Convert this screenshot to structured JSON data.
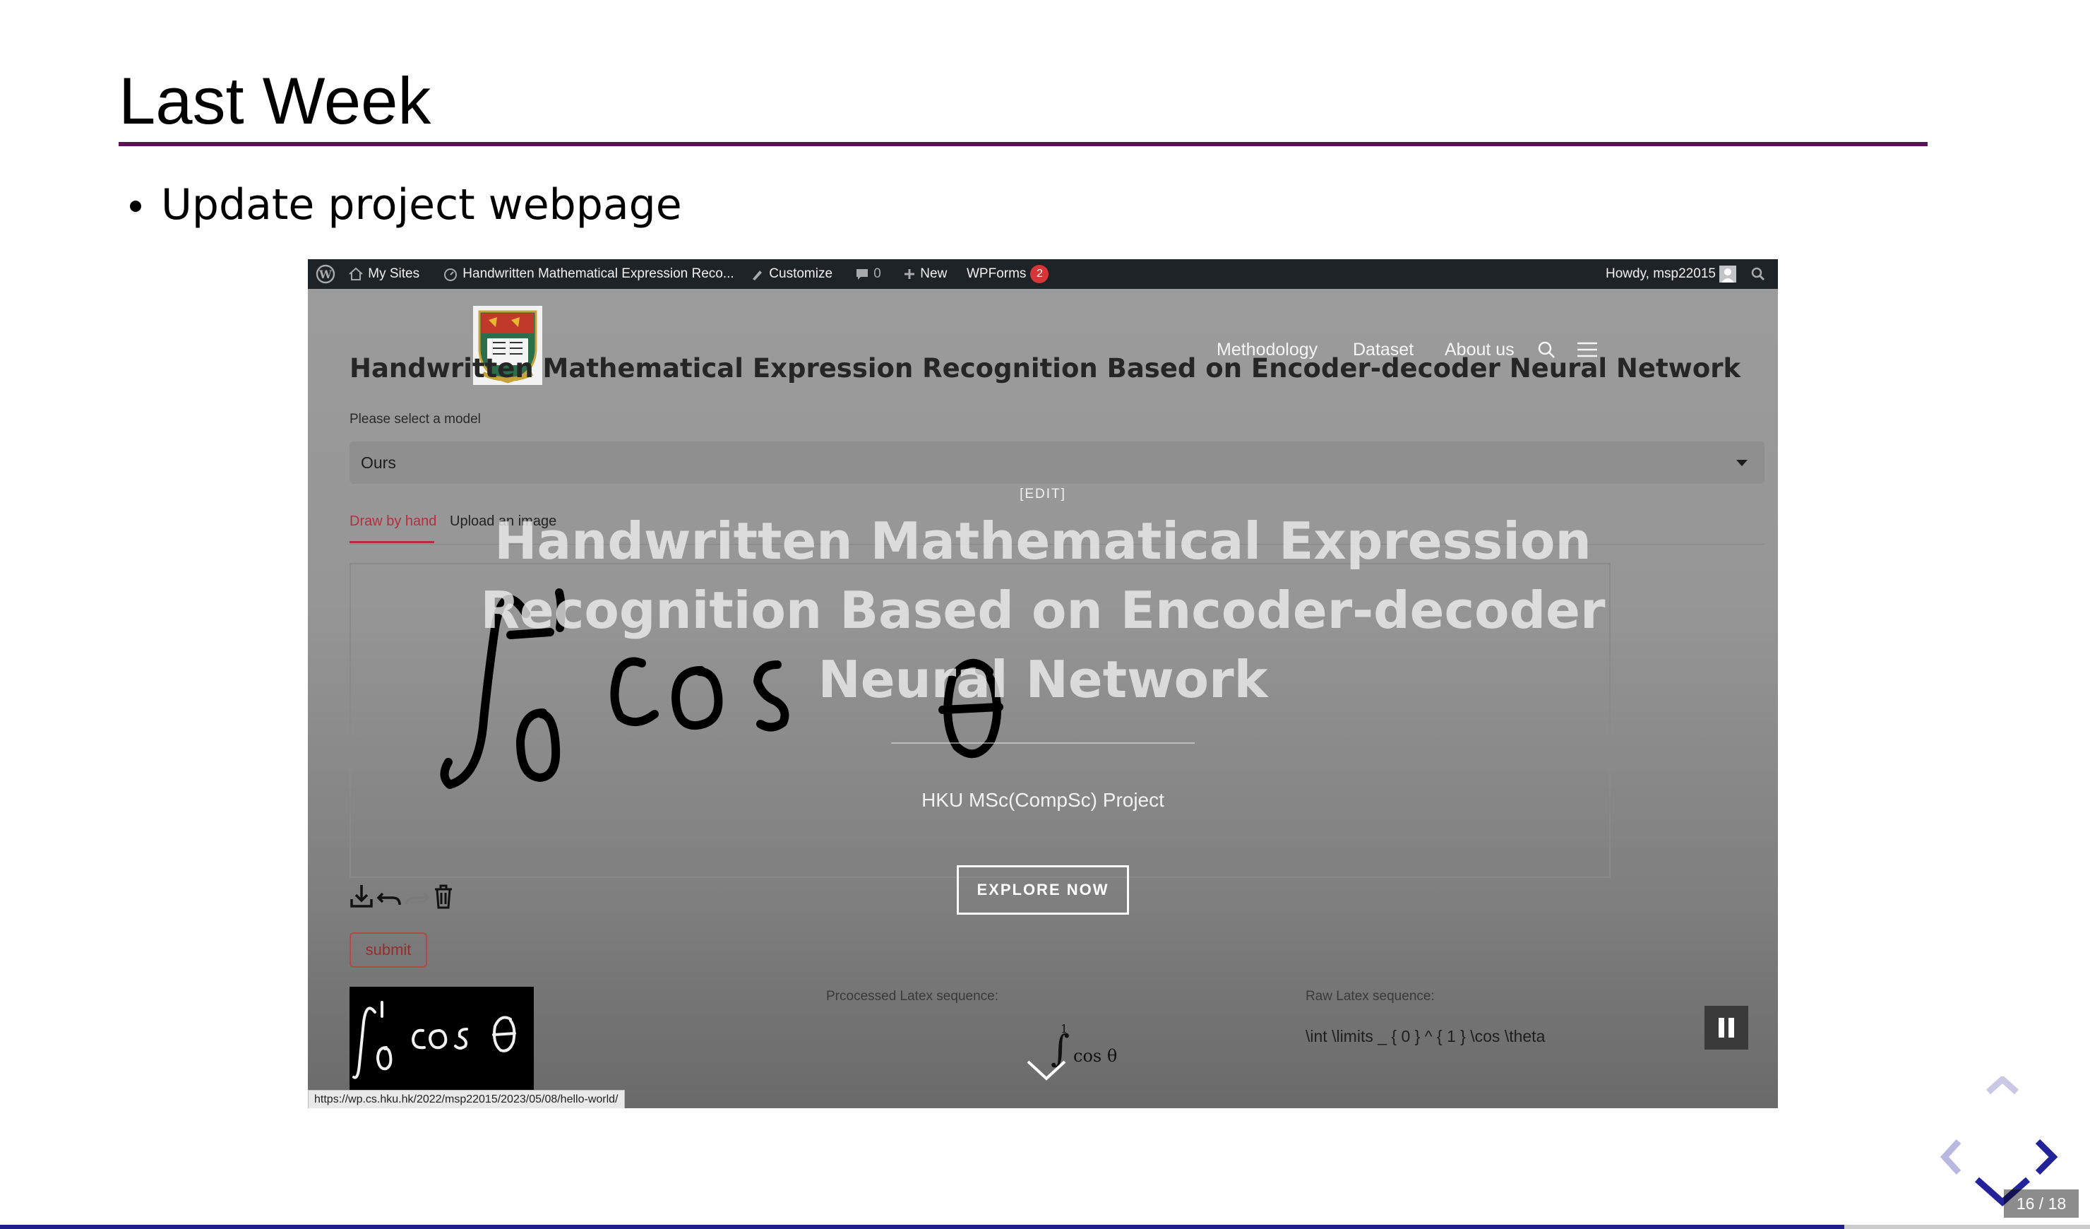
{
  "slide": {
    "title": "Last Week",
    "bullets": [
      "Update project webpage"
    ]
  },
  "wp_admin_bar": {
    "my_sites": "My Sites",
    "site_name": "Handwritten Mathematical Expression Reco...",
    "customize": "Customize",
    "comments_count": "0",
    "new": "New",
    "wpforms": "WPForms",
    "wpforms_badge": "2",
    "howdy": "Howdy, msp22015"
  },
  "site_nav": {
    "items": [
      "Methodology",
      "Dataset",
      "About us"
    ]
  },
  "app": {
    "title": "Handwritten Mathematical Expression Recognition Based on Encoder-decoder Neural Network",
    "select_label": "Please select a model",
    "select_value": "Ours",
    "tabs": [
      "Draw by hand",
      "Upload an image"
    ],
    "submit_label": "submit",
    "processed_label": "Prcocessed Latex sequence:",
    "raw_label": "Raw Latex sequence:",
    "raw_latex": "\\int \\limits _ { 0 } ^ { 1 } \\cos \\theta",
    "rendered_upper": "1",
    "rendered_body": "cos θ"
  },
  "hero": {
    "edit": "[EDIT]",
    "title": "Handwritten Mathematical Expression Recognition Based on Encoder-decoder Neural Network",
    "subtitle": "HKU MSc(CompSc) Project",
    "cta": "EXPLORE NOW"
  },
  "status_url": "https://wp.cs.hku.hk/2022/msp22015/2023/05/08/hello-world/",
  "reveal": {
    "slide_number": "16 / 18",
    "progress": 0.8824,
    "accent": "#1f1f8a"
  },
  "colors": {
    "title_rule": "#5b1457",
    "wp_bar": "#1d2327",
    "badge": "#d63638",
    "tab_active": "#b0303d"
  }
}
